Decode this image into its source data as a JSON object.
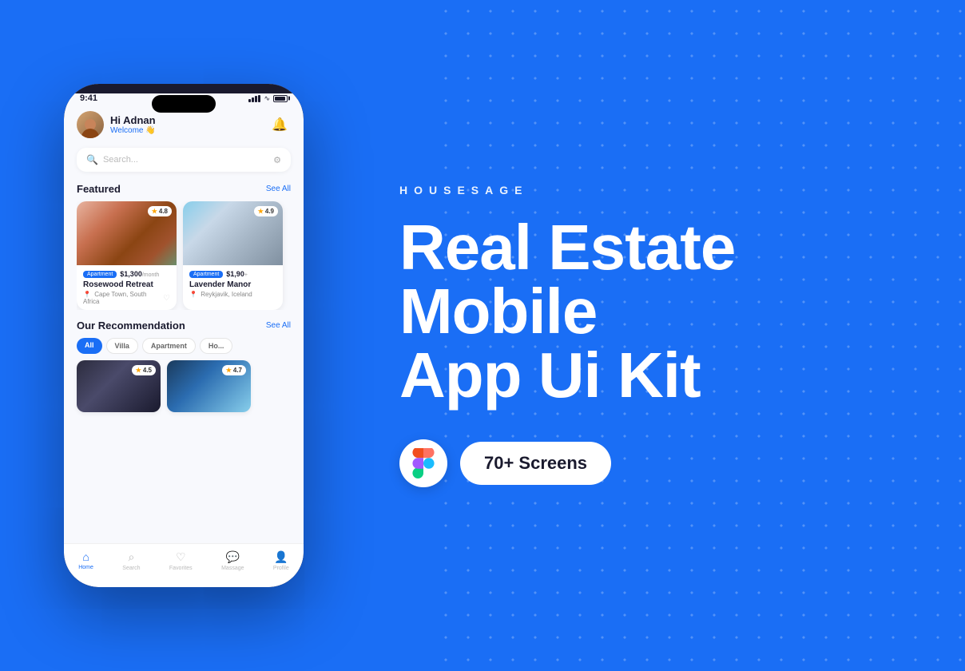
{
  "brand": {
    "name": "HOUSESAGE"
  },
  "hero": {
    "title_line1": "Real Estate",
    "title_line2": "Mobile",
    "title_line3": "App Ui Kit"
  },
  "cta": {
    "screens_label": "70+ Screens"
  },
  "status_bar": {
    "time": "9:41",
    "signal": "●●●",
    "wifi": "wifi",
    "battery": "battery"
  },
  "app": {
    "greeting": "Hi Adnan",
    "welcome": "Welcome 👋",
    "bell": "🔔",
    "search_placeholder": "Search...",
    "featured_label": "Featured",
    "featured_see_all": "See All",
    "recommendation_label": "Our Recommendation",
    "recommendation_see_all": "See All"
  },
  "featured_cards": [
    {
      "rating": "4.8",
      "tag": "Apartment",
      "price": "$1,300",
      "price_unit": "/month",
      "name": "Rosewood Retreat",
      "location": "Cape Town, South Africa"
    },
    {
      "rating": "4.9",
      "tag": "Apartment",
      "price": "$1,90",
      "price_unit": "+",
      "name": "Lavender Manor",
      "location": "Reykjavik, Iceland"
    }
  ],
  "filter_tabs": [
    {
      "label": "All",
      "active": true
    },
    {
      "label": "Villa",
      "active": false
    },
    {
      "label": "Apartment",
      "active": false
    },
    {
      "label": "Ho...",
      "active": false
    }
  ],
  "rec_cards": [
    {
      "rating": "4.5"
    },
    {
      "rating": "4.7"
    }
  ],
  "nav_items": [
    {
      "label": "Home",
      "active": true,
      "icon": "⌂"
    },
    {
      "label": "Search",
      "active": false,
      "icon": "⌕"
    },
    {
      "label": "Favorites",
      "active": false,
      "icon": "♡"
    },
    {
      "label": "Massage",
      "active": false,
      "icon": "💬"
    },
    {
      "label": "Profile",
      "active": false,
      "icon": "👤"
    }
  ]
}
